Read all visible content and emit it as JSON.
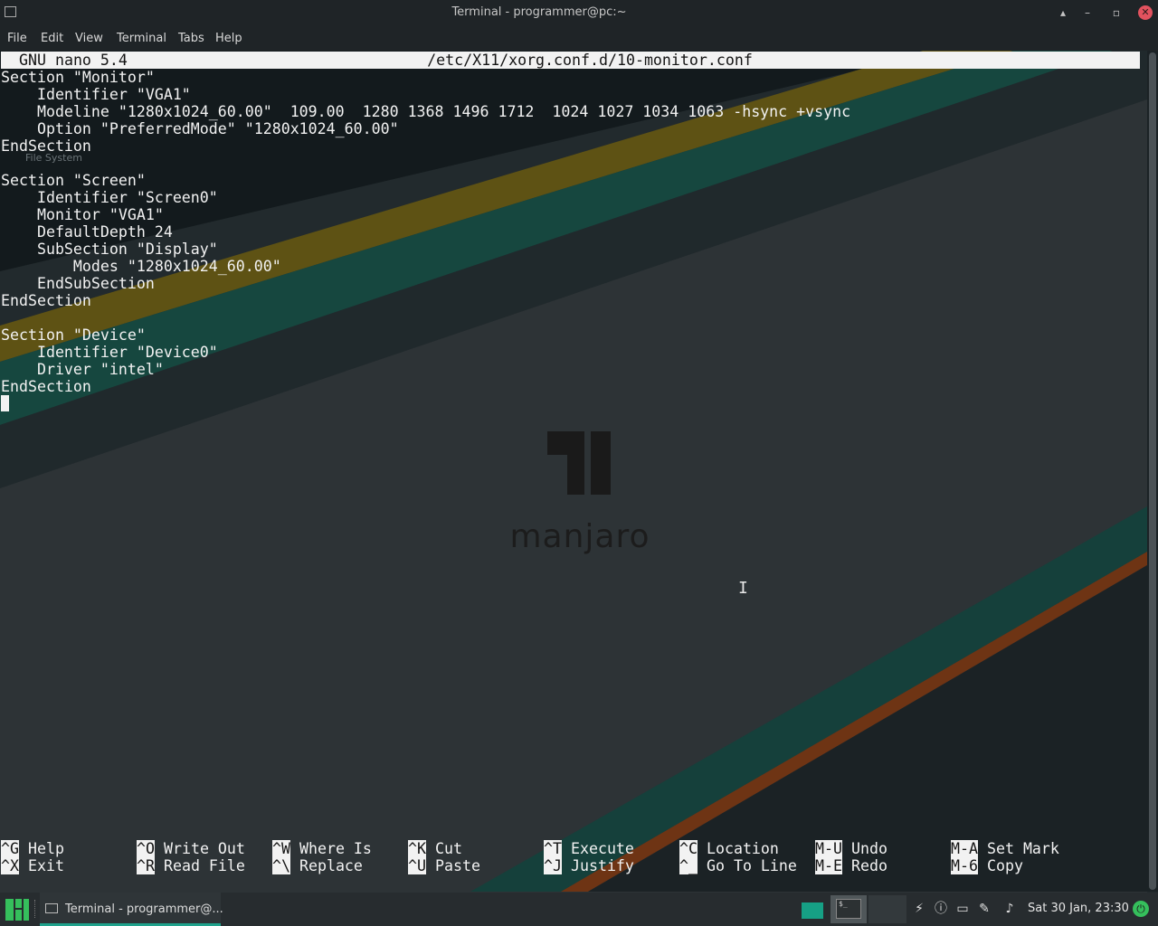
{
  "window": {
    "title": "Terminal - programmer@pc:~",
    "controls": [
      "▴",
      "–",
      "▫",
      "✕"
    ]
  },
  "menubar": {
    "items": [
      "File",
      "Edit",
      "View",
      "Terminal",
      "Tabs",
      "Help"
    ]
  },
  "nano": {
    "version": "GNU nano 5.4",
    "filename": "/etc/X11/xorg.conf.d/10-monitor.conf",
    "lines": [
      "Section \"Monitor\"",
      "    Identifier \"VGA1\"",
      "    Modeline \"1280x1024_60.00\"  109.00  1280 1368 1496 1712  1024 1027 1034 1063 -hsync +vsync",
      "    Option \"PreferredMode\" \"1280x1024_60.00\"",
      "EndSection",
      "",
      "Section \"Screen\"",
      "    Identifier \"Screen0\"",
      "    Monitor \"VGA1\"",
      "    DefaultDepth 24",
      "    SubSection \"Display\"",
      "        Modes \"1280x1024_60.00\"",
      "    EndSubSection",
      "EndSection",
      "",
      "Section \"Device\"",
      "    Identifier \"Device0\"",
      "    Driver \"intel\"",
      "EndSection"
    ],
    "shortcuts_row1": [
      {
        "key": "^G",
        "label": "Help"
      },
      {
        "key": "^O",
        "label": "Write Out"
      },
      {
        "key": "^W",
        "label": "Where Is"
      },
      {
        "key": "^K",
        "label": "Cut"
      },
      {
        "key": "^T",
        "label": "Execute"
      },
      {
        "key": "^C",
        "label": "Location"
      },
      {
        "key": "M-U",
        "label": "Undo"
      },
      {
        "key": "M-A",
        "label": "Set Mark"
      }
    ],
    "shortcuts_row2": [
      {
        "key": "^X",
        "label": "Exit"
      },
      {
        "key": "^R",
        "label": "Read File"
      },
      {
        "key": "^\\",
        "label": "Replace"
      },
      {
        "key": "^U",
        "label": "Paste"
      },
      {
        "key": "^J",
        "label": "Justify"
      },
      {
        "key": "^_",
        "label": "Go To Line"
      },
      {
        "key": "M-E",
        "label": "Redo"
      },
      {
        "key": "M-6",
        "label": "Copy"
      }
    ]
  },
  "desktop": {
    "ghost_icon_label": "File System",
    "logo_text": "manjaro",
    "colors": {
      "teal": "#1a5c52",
      "amber": "#6b5a12",
      "orange": "#8a3a14",
      "accent": "#35bf5c"
    }
  },
  "taskbar": {
    "task_label": "Terminal - programmer@...",
    "workspace_prompt": "$_",
    "clock": "Sat 30 Jan, 23:30",
    "tray_icons": [
      "network-icon",
      "security-icon",
      "display-icon",
      "clip-icon",
      "volume-icon"
    ]
  }
}
